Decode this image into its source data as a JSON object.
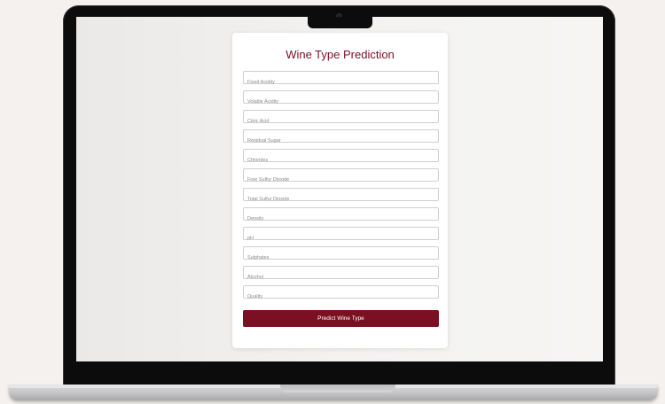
{
  "form": {
    "title": "Wine Type Prediction",
    "fields": [
      {
        "name": "fixed_acidity",
        "placeholder": "Fixed Acidity",
        "value": ""
      },
      {
        "name": "volatile_acidity",
        "placeholder": "Volatile Acidity",
        "value": ""
      },
      {
        "name": "citric_acid",
        "placeholder": "Citric Acid",
        "value": ""
      },
      {
        "name": "residual_sugar",
        "placeholder": "Residual Sugar",
        "value": ""
      },
      {
        "name": "chlorides",
        "placeholder": "Chlorides",
        "value": ""
      },
      {
        "name": "free_sulfur_dioxide",
        "placeholder": "Free Sulfur Dioxide",
        "value": ""
      },
      {
        "name": "total_sulfur_dioxide",
        "placeholder": "Total Sulfur Dioxide",
        "value": ""
      },
      {
        "name": "density",
        "placeholder": "Density",
        "value": ""
      },
      {
        "name": "ph",
        "placeholder": "pH",
        "value": ""
      },
      {
        "name": "sulphates",
        "placeholder": "Sulphates",
        "value": ""
      },
      {
        "name": "alcohol",
        "placeholder": "Alcohol",
        "value": ""
      },
      {
        "name": "quality",
        "placeholder": "Quality",
        "value": ""
      }
    ],
    "submit_label": "Predict Wine Type"
  },
  "colors": {
    "accent": "#7a1022",
    "title": "#7c1023",
    "background": "#f4f1ee"
  }
}
